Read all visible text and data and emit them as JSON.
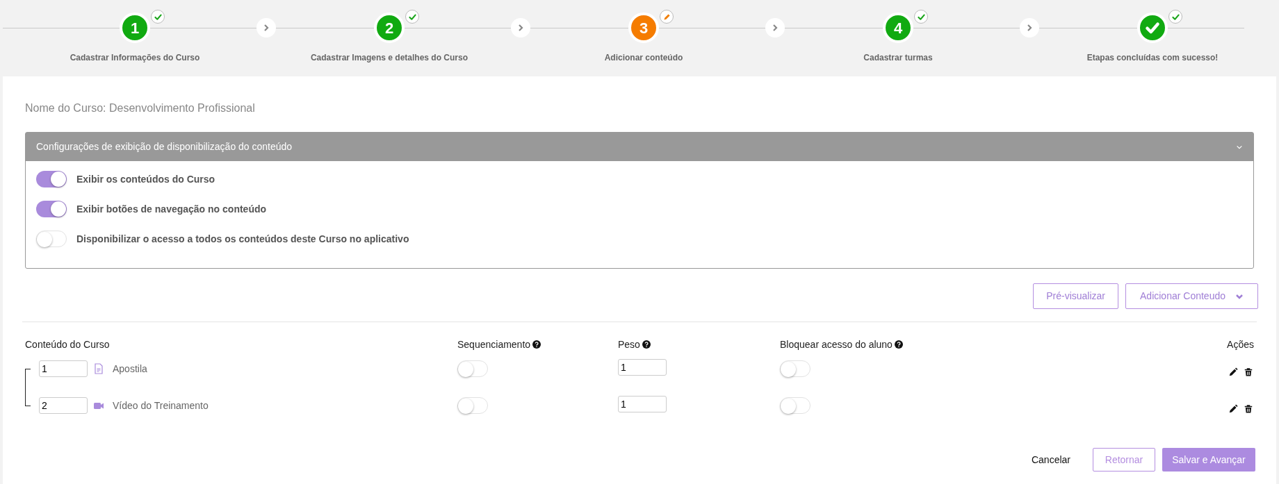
{
  "steps": [
    {
      "kind": "number",
      "number": "1",
      "label": "Cadastrar Informações do Curso",
      "current": false
    },
    {
      "kind": "number",
      "number": "2",
      "label": "Cadastrar Imagens e detalhes do Curso",
      "current": false
    },
    {
      "kind": "number",
      "number": "3",
      "label": "Adicionar conteúdo",
      "current": true
    },
    {
      "kind": "number",
      "number": "4",
      "label": "Cadastrar turmas",
      "current": false
    },
    {
      "kind": "final",
      "label": "Etapas concluídas com sucesso!",
      "current": false
    }
  ],
  "course_name": "Nome do Curso: Desenvolvimento Profissional",
  "settings_panel": {
    "title": "Configurações de exibição de disponibilização do conteúdo",
    "expanded": true,
    "options": [
      {
        "label": "Exibir os conteúdos do Curso",
        "on": true
      },
      {
        "label": "Exibir botões de navegação no conteúdo",
        "on": true
      },
      {
        "label": "Disponibilizar o acesso a todos os conteúdos deste Curso no aplicativo",
        "on": false
      }
    ]
  },
  "toolbar_buttons": [
    {
      "label": "Pré-visualizar",
      "dropdown": false
    },
    {
      "label": "Adicionar Conteudo",
      "dropdown": true
    }
  ],
  "table": {
    "columns": [
      {
        "label": "Conteúdo do Curso",
        "help": false
      },
      {
        "label": "Sequenciamento",
        "help": true
      },
      {
        "label": "Peso",
        "help": true
      },
      {
        "label": "Bloquear acesso do aluno",
        "help": true
      },
      {
        "label": "Ações",
        "help": false
      }
    ],
    "rows": [
      {
        "order": "1",
        "kind": "pdf",
        "title": "Apostila",
        "sequencing": false,
        "weight": "1",
        "block_access": false
      },
      {
        "order": "2",
        "kind": "video",
        "title": "Vídeo do Treinamento",
        "sequencing": false,
        "weight": "1",
        "block_access": false
      }
    ]
  },
  "footer_buttons": [
    {
      "kind": "text",
      "label": "Cancelar"
    },
    {
      "kind": "outline",
      "label": "Retornar"
    },
    {
      "kind": "primary",
      "label": "Salvar e Avançar"
    }
  ]
}
